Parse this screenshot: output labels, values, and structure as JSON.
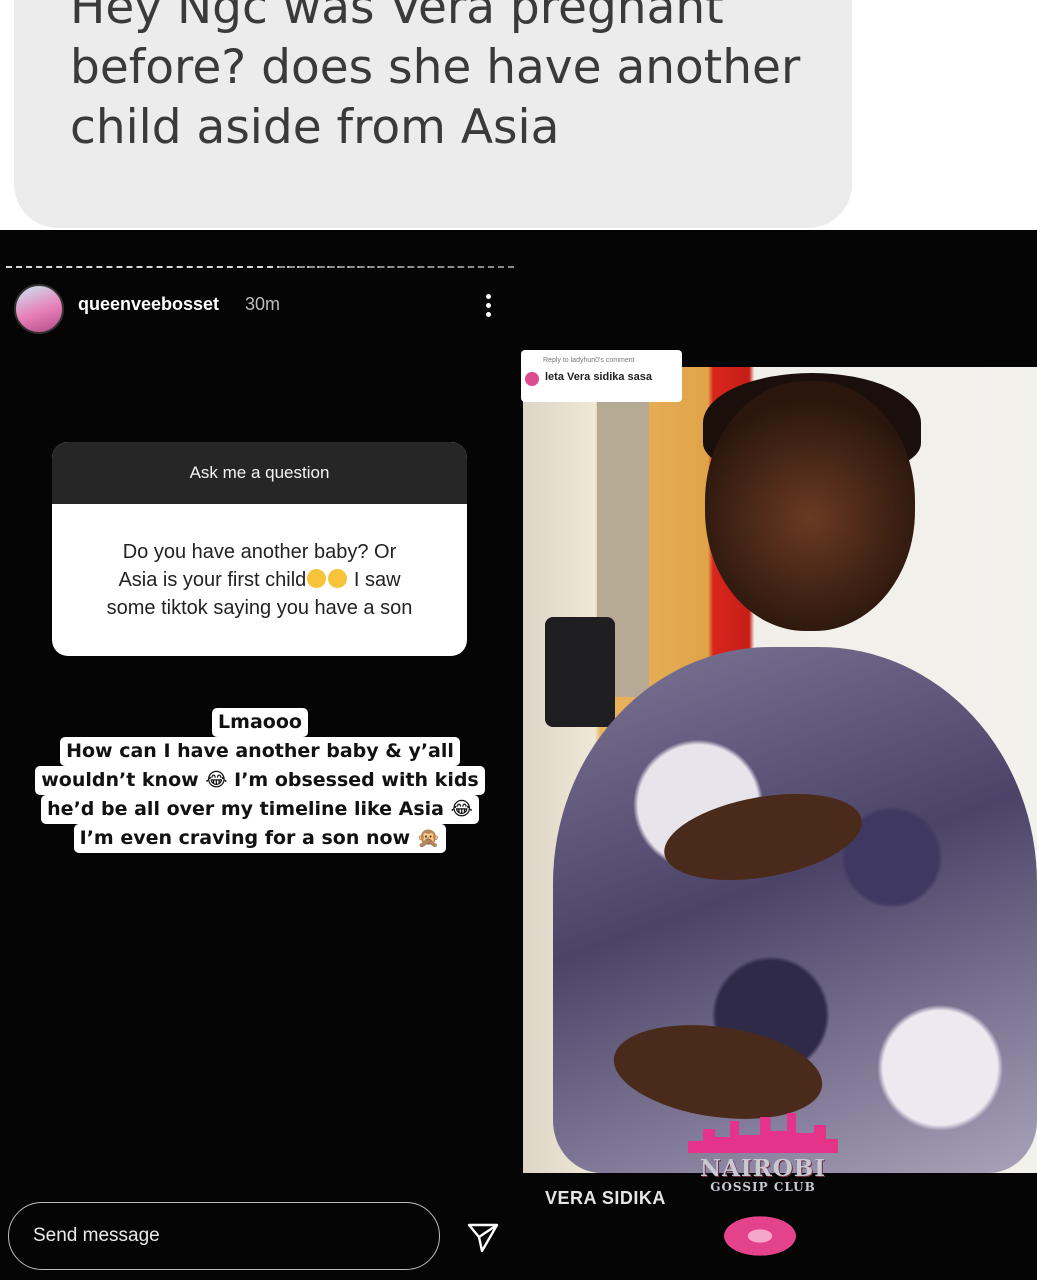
{
  "header_question": {
    "text": "Hey Ngc was Vera pregnant before? does she have another child aside from Asia"
  },
  "story": {
    "username": "queenveebosset",
    "time": "30m",
    "sticker": {
      "title": "Ask me a question",
      "question_line1": "Do you have another baby? Or",
      "question_line2a": "Asia is your first child",
      "question_line2b": "I saw",
      "question_line3": "some tiktok saying you have a son"
    },
    "reply_lines": [
      "Lmaooo",
      "How can I have another baby & y’all",
      "wouldn’t  know 😂 I’m obsessed with kids",
      "he’d be all over my timeline like Asia 😂",
      "I’m even craving for a son now 🙊"
    ],
    "send_placeholder": "Send message"
  },
  "photo": {
    "reply_tag_small": "Reply to ladyhun0's comment",
    "reply_tag_text": "leta Vera sidika sasa",
    "watermark_line1": "NAIROBI",
    "watermark_line2": "GOSSIP CLUB",
    "caption": "VERA SIDIKA"
  }
}
